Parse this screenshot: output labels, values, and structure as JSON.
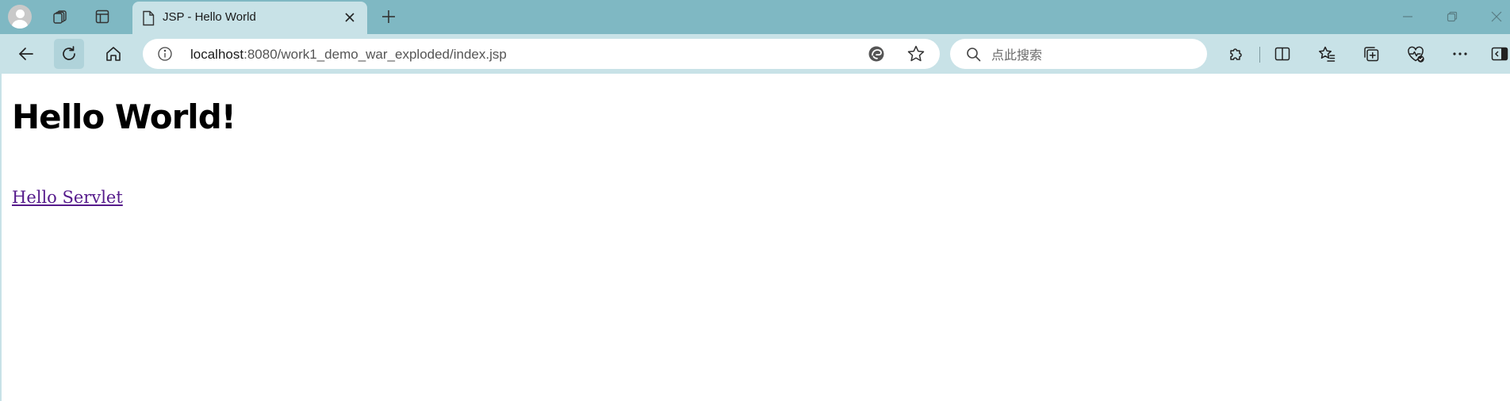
{
  "tab": {
    "title": "JSP - Hello World"
  },
  "address_bar": {
    "host": "localhost",
    "path": ":8080/work1_demo_war_exploded/index.jsp"
  },
  "search": {
    "placeholder": "点此搜索"
  },
  "page": {
    "heading": "Hello World!",
    "link_text": "Hello Servlet"
  },
  "colors": {
    "tab_strip": "#7fb8c3",
    "toolbar": "#c8e2e7",
    "visited_link": "#551a8b"
  },
  "icons": {
    "tab_strip": [
      "profile-avatar-icon",
      "workspaces-icon",
      "vertical-tabs-icon",
      "document-icon",
      "close-icon",
      "plus-icon"
    ],
    "window": [
      "minimize-icon",
      "restore-icon",
      "window-close-icon"
    ],
    "toolbar": [
      "back-arrow-icon",
      "refresh-icon",
      "home-icon",
      "info-icon",
      "read-aloud-icon",
      "star-icon",
      "search-icon",
      "extensions-icon",
      "split-screen-icon",
      "favorites-icon",
      "collections-icon",
      "browser-essentials-icon",
      "more-icon",
      "sidebar-icon"
    ]
  }
}
